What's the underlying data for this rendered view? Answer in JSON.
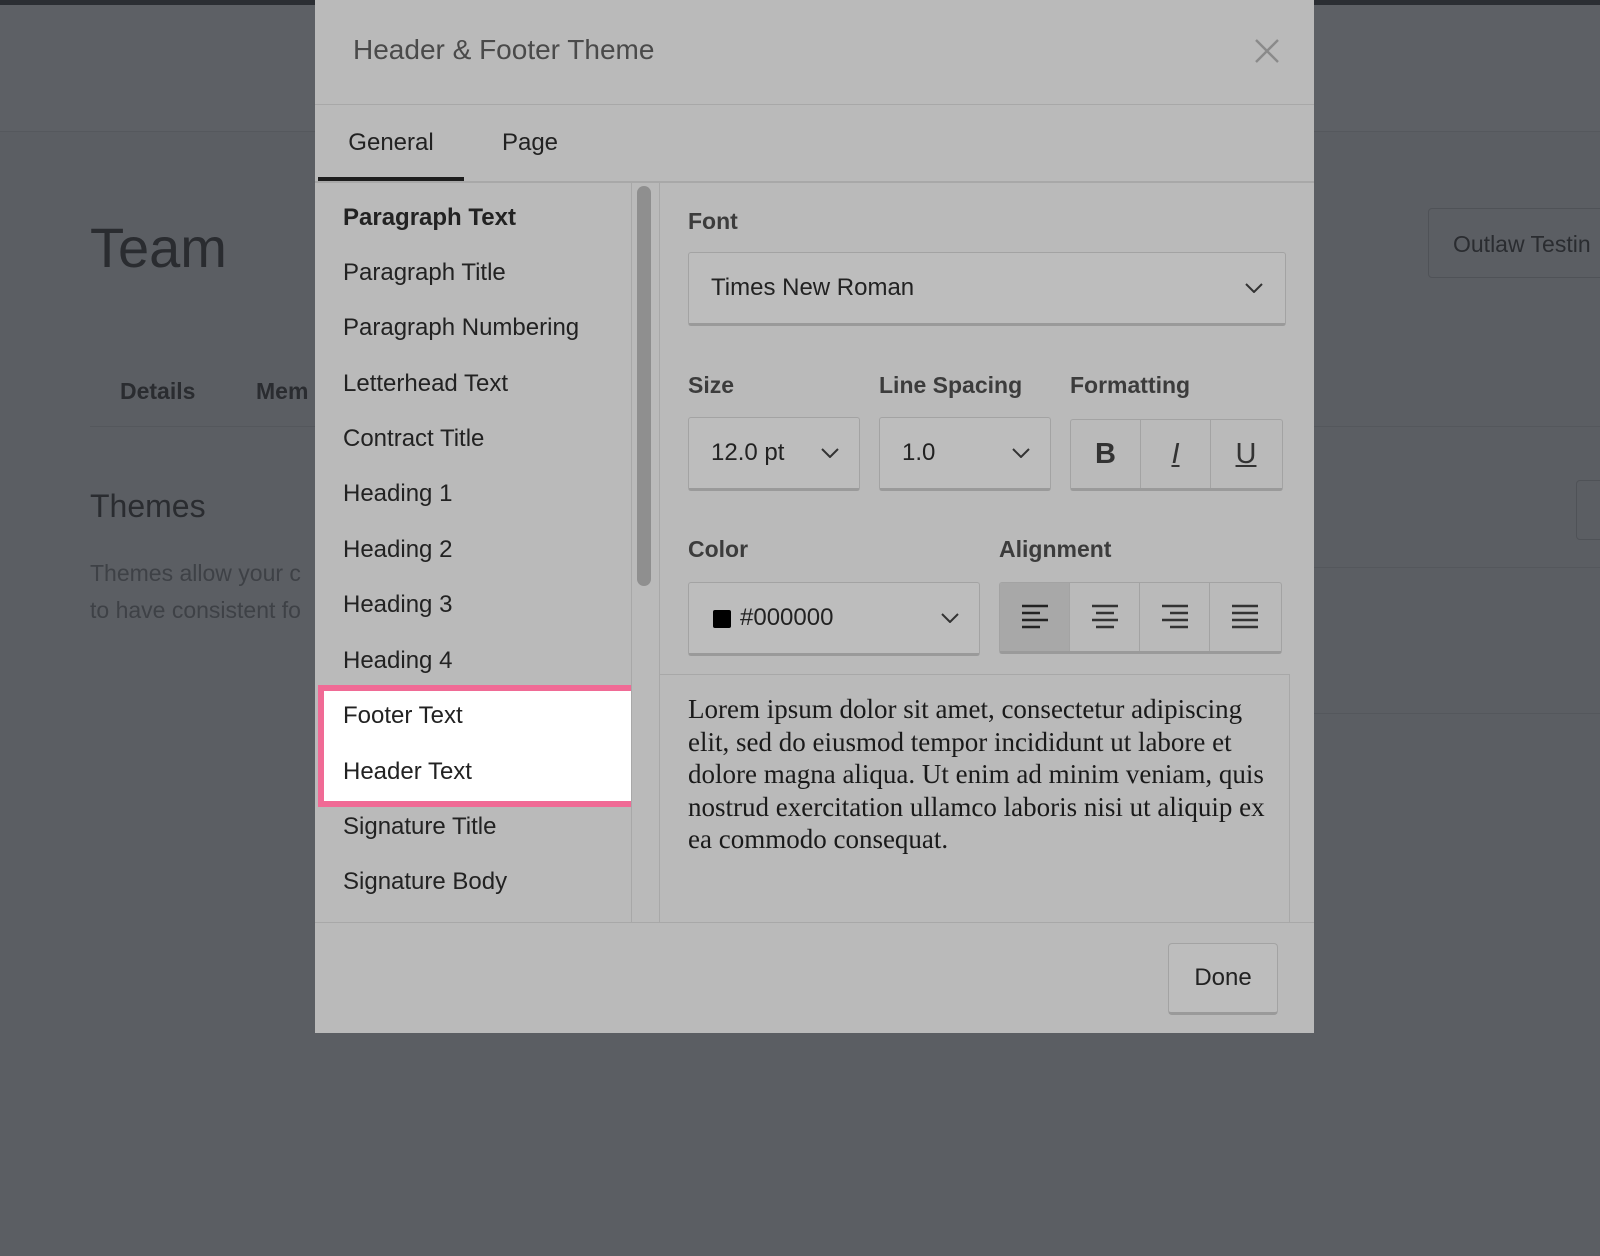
{
  "background": {
    "page_title": "Team",
    "team_button_label": "Outlaw Testin",
    "tabs": [
      "Details",
      "Mem"
    ],
    "themes_title": "Themes",
    "themes_desc_line1": "Themes allow your c",
    "themes_desc_line2": "to have consistent fo"
  },
  "modal": {
    "title": "Header & Footer Theme",
    "tabs": [
      {
        "label": "General",
        "active": true
      },
      {
        "label": "Page",
        "active": false
      }
    ],
    "style_list": [
      "Paragraph Text",
      "Paragraph Title",
      "Paragraph Numbering",
      "Letterhead Text",
      "Contract Title",
      "Heading 1",
      "Heading 2",
      "Heading 3",
      "Heading 4",
      "Footer Text",
      "Header Text",
      "Signature Title",
      "Signature Body"
    ],
    "highlighted_items": [
      "Footer Text",
      "Header Text"
    ],
    "form": {
      "font_label": "Font",
      "font_value": "Times New Roman",
      "size_label": "Size",
      "size_value": "12.0 pt",
      "line_spacing_label": "Line Spacing",
      "line_spacing_value": "1.0",
      "formatting_label": "Formatting",
      "bold": "B",
      "italic": "I",
      "underline": "U",
      "color_label": "Color",
      "color_value": "#000000",
      "alignment_label": "Alignment",
      "alignment_selected": "left"
    },
    "preview_text": "Lorem ipsum dolor sit amet, consectetur adipiscing elit, sed do eiusmod tempor incididunt ut labore et dolore magna aliqua. Ut enim ad minim veniam, quis nostrud exercitation ullamco laboris nisi ut aliquip ex ea commodo consequat.",
    "done_label": "Done"
  },
  "colors": {
    "overlay": "#5b5e63",
    "modal_bg": "#bababa",
    "highlight_border": "#f06a95",
    "swatch": "#000000"
  }
}
